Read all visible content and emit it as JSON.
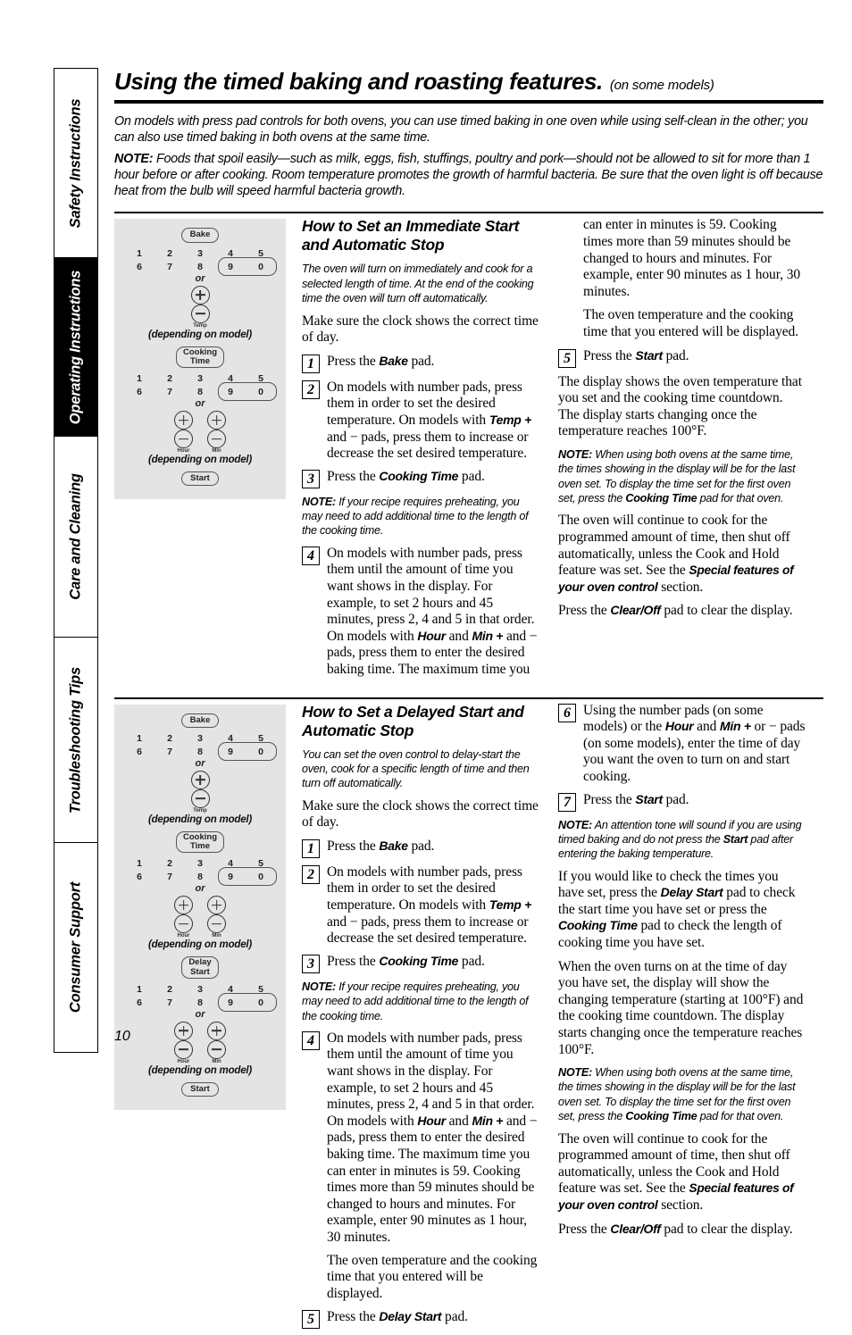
{
  "sidebar": {
    "tabs": [
      {
        "label": "Safety Instructions",
        "active": false
      },
      {
        "label": "Operating Instructions",
        "active": true
      },
      {
        "label": "Care and Cleaning",
        "active": false
      },
      {
        "label": "Troubleshooting Tips",
        "active": false
      },
      {
        "label": "Consumer Support",
        "active": false
      }
    ]
  },
  "page": {
    "number": "10",
    "title_main": "Using the timed baking and roasting features.",
    "title_sub": "(on some models)",
    "intro": [
      "On models with press pad controls for both ovens, you can use timed baking in one oven while using self-clean in the other; you can also use timed baking in both ovens at the same time.",
      "Foods that spoil easily—such as milk, eggs, fish, stuffings, poultry and pork—should not be allowed to sit for more than 1 hour before or after cooking. Room temperature promotes the growth of harmful bacteria. Be sure that the oven light is off because heat from the bulb will speed harmful bacteria growth."
    ],
    "note_label": "NOTE:"
  },
  "diagram": {
    "pad_bake": "Bake",
    "pad_cooking_time_l1": "Cooking",
    "pad_cooking_time_l2": "Time",
    "pad_delay_start_l1": "Delay",
    "pad_delay_start_l2": "Start",
    "pad_start": "Start",
    "row_top": [
      "1",
      "2",
      "3",
      "4",
      "5"
    ],
    "row_bottom": [
      "6",
      "7",
      "8",
      "9",
      "0"
    ],
    "or": "or",
    "label_temp": "Temp",
    "label_hour": "Hour",
    "label_min": "Min",
    "depending": "(depending on model)"
  },
  "section1": {
    "heading": "How to Set an Immediate Start and Automatic Stop",
    "lead": "The oven will turn on immediately and cook for a selected length of time. At the end of the cooking time the oven will turn off automatically.",
    "clock_p": "Make sure the clock shows the correct time of day.",
    "steps": [
      {
        "num": "1",
        "text_pre": "Press the ",
        "bold": "Bake",
        "text_post": " pad."
      },
      {
        "num": "2",
        "text": "On models with number pads, press them in order to set the desired temperature. On models with <b>Temp +</b> and − pads, press them to increase or decrease the set desired temperature."
      },
      {
        "num": "3",
        "text_pre": "Press the ",
        "bold": "Cooking Time",
        "text_post": " pad."
      },
      {
        "num": "4",
        "text": "On models with number pads, press them until the amount of time you want shows in the display. For example, to set 2 hours and 45 minutes, press 2, 4 and 5 in that order. On models with <b>Hour</b> and <b>Min +</b> and − pads, press them to enter the desired baking time. The maximum time you"
      },
      {
        "num": "5",
        "text_pre": "Press the ",
        "bold": "Start",
        "text_post": " pad."
      }
    ],
    "note1_label": "NOTE:",
    "note1": "If your recipe requires preheating, you may need to add additional time to the length of the cooking time.",
    "cont_step4": "can enter in minutes is 59. Cooking times more than 59 minutes should be changed to hours and minutes. For example, enter 90 minutes as 1 hour, 30 minutes.",
    "display_p": "The oven temperature and the cooking time that you entered will be displayed.",
    "after_start": "The display shows the oven temperature that you set and the cooking time countdown. The display starts changing once the temperature reaches 100°F.",
    "note2_label": "NOTE:",
    "note2": "When using both ovens at the same time, the times showing in the display will be for the last oven set. To display the time set for the first oven set, press the <b>Cooking Time</b> pad for that oven.",
    "continue_p": "The oven will continue to cook for the programmed amount of time, then shut off automatically, unless the Cook and Hold feature was set. See the <i>Special features of your oven control</i> section.",
    "clear_p": "Press the <b>Clear/Off</b> pad to clear the display."
  },
  "section2": {
    "heading": "How to Set a Delayed Start and Automatic Stop",
    "lead": "You can set the oven control to delay-start the oven, cook for a specific length of time and then turn off automatically.",
    "clock_p": "Make sure the clock shows the correct time of day.",
    "steps": [
      {
        "num": "1",
        "text_pre": "Press the ",
        "bold": "Bake",
        "text_post": " pad."
      },
      {
        "num": "2",
        "text": "On models with number pads, press them in order to set the desired temperature. On models with <b>Temp +</b> and − pads, press them to increase or decrease the set desired temperature."
      },
      {
        "num": "3",
        "text_pre": "Press the ",
        "bold": "Cooking Time",
        "text_post": " pad."
      },
      {
        "num": "4",
        "text": "On models with number pads, press them until the amount of time you want shows in the display. For example, to set 2 hours and 45 minutes, press 2, 4 and 5 in that order. On models with <b>Hour</b> and <b>Min +</b> and − pads, press them to enter the desired baking time. The maximum time you can enter in minutes is 59. Cooking times more than 59 minutes should be changed to hours and minutes. For example, enter 90 minutes as 1 hour, 30 minutes."
      },
      {
        "num": "5",
        "text_pre": "Press the ",
        "bold": "Delay Start",
        "text_post": " pad."
      },
      {
        "num": "6",
        "text": "Using the number pads (on some models) or the <b>Hour</b> and <b>Min +</b> or − pads (on some models), enter the time of day you want the oven to turn on and start cooking."
      },
      {
        "num": "7",
        "text_pre": "Press the ",
        "bold": "Start",
        "text_post": " pad."
      }
    ],
    "note1_label": "NOTE:",
    "note1": "If your recipe requires preheating, you may need to add additional time to the length of the cooking time.",
    "display_p": "The oven temperature and the cooking time that you entered will be displayed.",
    "note2_label": "NOTE:",
    "note2": "An attention tone will sound if you are using timed baking and do not press the <b>Start</b> pad after entering the baking temperature.",
    "check_p": "If you would like to check the times you have set, press the <b>Delay Start</b> pad to check the start time you have set or press the <b>Cooking Time</b> pad to check the length of cooking time you have set.",
    "turns_on_p": "When the oven turns on at the time of day you have set, the display will show the changing temperature (starting at 100°F) and the cooking time countdown. The display starts changing once the temperature reaches 100°F.",
    "note3_label": "NOTE:",
    "note3": "When using both ovens at the same time, the times showing in the display will be for the last oven set. To display the time set for the first oven set, press the <b>Cooking Time</b> pad for that oven.",
    "continue_p": "The oven will continue to cook for the programmed amount of time, then shut off automatically, unless the Cook and Hold feature was set. See the <i>Special features of your oven control</i> section.",
    "clear_p": "Press the <b>Clear/Off</b> pad to clear the display."
  },
  "colors": {
    "panel_bg": "#e4e4e4",
    "ink": "#000000"
  }
}
